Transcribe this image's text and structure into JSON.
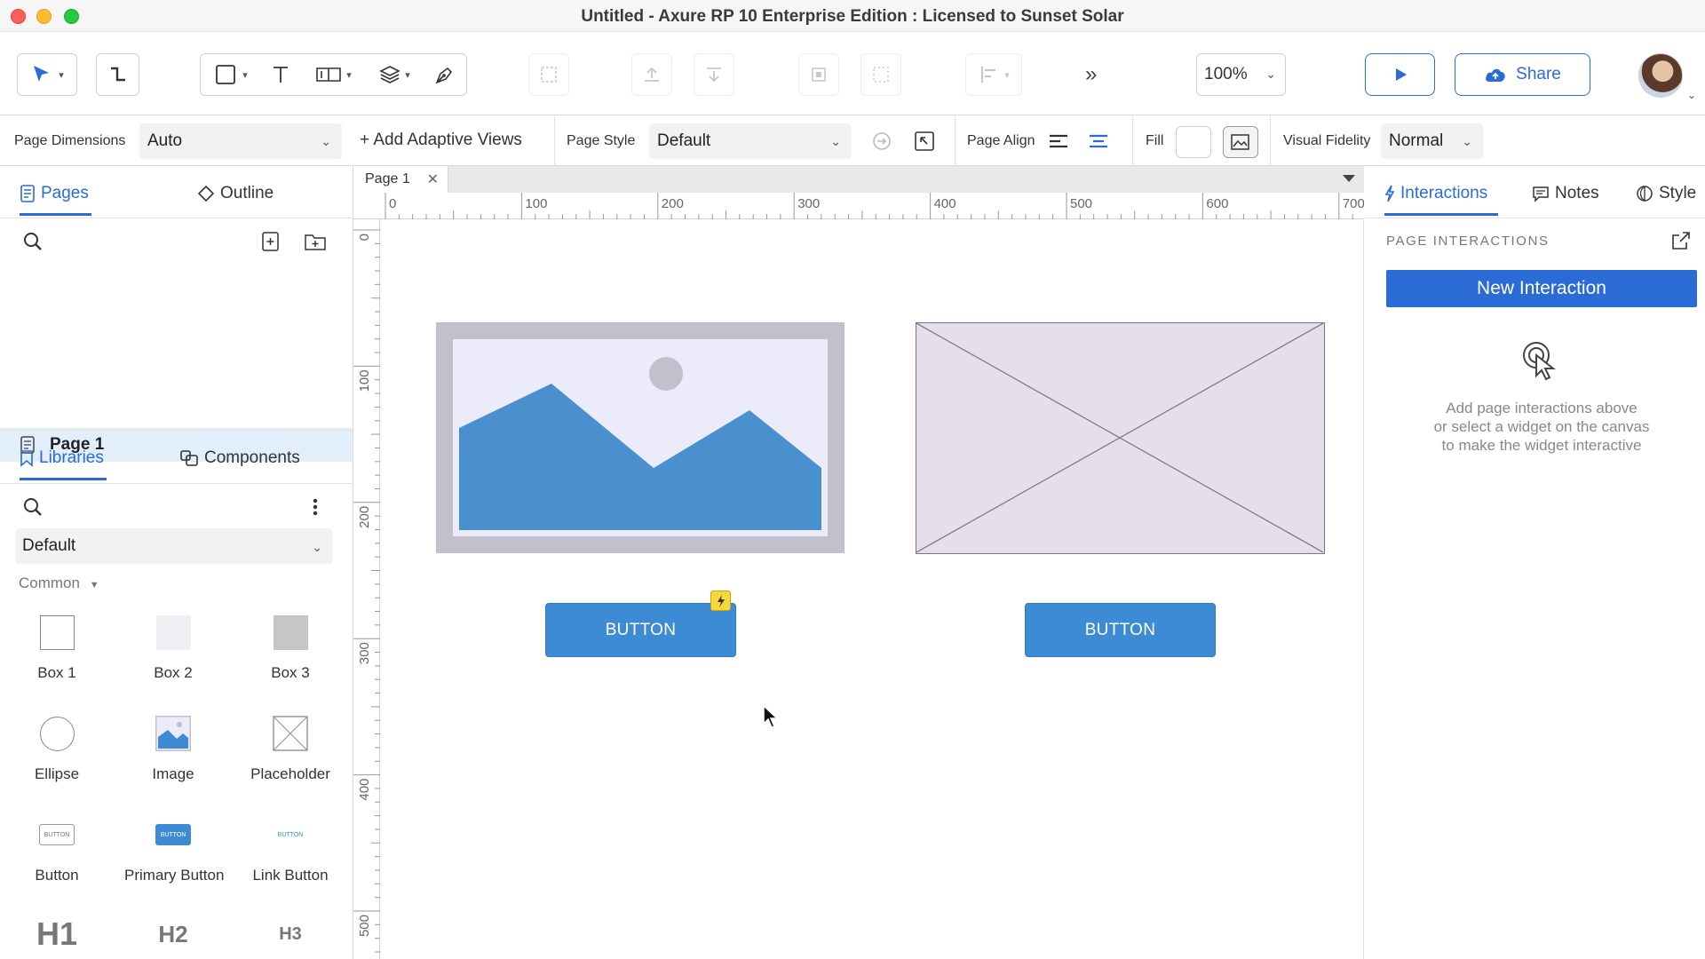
{
  "window": {
    "title": "Untitled - Axure RP 10 Enterprise Edition : Licensed to Sunset Solar"
  },
  "toolbar": {
    "zoom_value": "100%",
    "share_label": "Share"
  },
  "page_style_bar": {
    "page_dimensions_label": "Page Dimensions",
    "page_dimensions_value": "Auto",
    "add_adaptive_views_label": "+ Add Adaptive Views",
    "page_style_label": "Page Style",
    "page_style_value": "Default",
    "page_align_label": "Page Align",
    "fill_label": "Fill",
    "visual_fidelity_label": "Visual Fidelity",
    "visual_fidelity_value": "Normal"
  },
  "left_panel": {
    "tabs": {
      "pages": "Pages",
      "outline": "Outline"
    },
    "pages": [
      {
        "label": "Page 1"
      }
    ],
    "lib_tabs": {
      "libraries": "Libraries",
      "components": "Components"
    },
    "library_select": "Default",
    "category": "Common",
    "widgets": [
      {
        "label": "Box 1"
      },
      {
        "label": "Box 2"
      },
      {
        "label": "Box 3"
      },
      {
        "label": "Ellipse"
      },
      {
        "label": "Image"
      },
      {
        "label": "Placeholder"
      },
      {
        "label": "Button"
      },
      {
        "label": "Primary Button"
      },
      {
        "label": "Link Button"
      }
    ],
    "widget_glyphs": {
      "button": "BUTTON",
      "h1": "H1",
      "h2": "H2",
      "h3": "H3"
    }
  },
  "canvas": {
    "doc_tab": "Page 1",
    "ruler_h": [
      "0",
      "100",
      "200",
      "300",
      "400",
      "500",
      "600",
      "700"
    ],
    "ruler_v": [
      "0",
      "100",
      "200",
      "300",
      "400",
      "500"
    ],
    "buttons": [
      "BUTTON",
      "BUTTON"
    ]
  },
  "right_panel": {
    "tabs": {
      "interactions": "Interactions",
      "notes": "Notes",
      "style": "Style"
    },
    "section_label": "PAGE INTERACTIONS",
    "new_interaction": "New Interaction",
    "hint": [
      "Add page interactions above",
      "or select a widget on the canvas",
      "to make the widget interactive"
    ]
  },
  "colors": {
    "accent": "#2a6bd6",
    "widget_button": "#3d8bd4",
    "page_selected": "#e3eefb",
    "interaction_badge": "#f7d83a"
  },
  "icons": [
    "select-arrow-icon",
    "connector-icon",
    "rectangle-icon",
    "text-icon",
    "input-icon",
    "layers-icon",
    "pen-icon",
    "group-icon",
    "bring-forward-icon",
    "send-backward-icon",
    "align-icon",
    "distribute-icon",
    "more-icon",
    "play-icon",
    "cloud-upload-icon",
    "search-icon",
    "add-page-icon",
    "add-folder-icon",
    "bookmark-icon",
    "components-icon",
    "more-vertical-icon",
    "lightning-icon",
    "notes-icon",
    "style-icon",
    "pop-out-icon",
    "touch-cursor-icon"
  ]
}
